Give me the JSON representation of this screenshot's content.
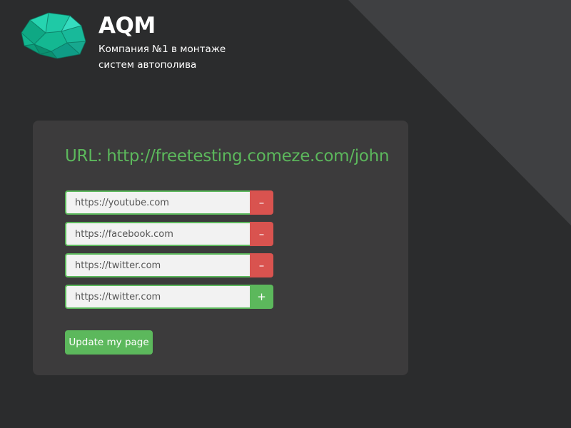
{
  "header": {
    "brand_name": "AQM",
    "tagline": "Компания №1 в монтаже систем автополива",
    "logo_icon": "crystal-gem-icon"
  },
  "panel": {
    "url_label": "URL:",
    "url_value": "http://freetesting.comeze.com/john",
    "links": [
      {
        "value": "https://youtube.com",
        "action": "remove",
        "action_label": "–"
      },
      {
        "value": "https://facebook.com",
        "action": "remove",
        "action_label": "–"
      },
      {
        "value": "https://twitter.com",
        "action": "remove",
        "action_label": "–"
      },
      {
        "value": "https://twitter.com",
        "action": "add",
        "action_label": "+"
      }
    ],
    "update_label": "Update my page"
  },
  "colors": {
    "background": "#2b2c2d",
    "panel": "#3c3b3c",
    "accent_green": "#5cb85c",
    "danger_red": "#d9534f",
    "logo_teal": "#1fc9a6"
  }
}
